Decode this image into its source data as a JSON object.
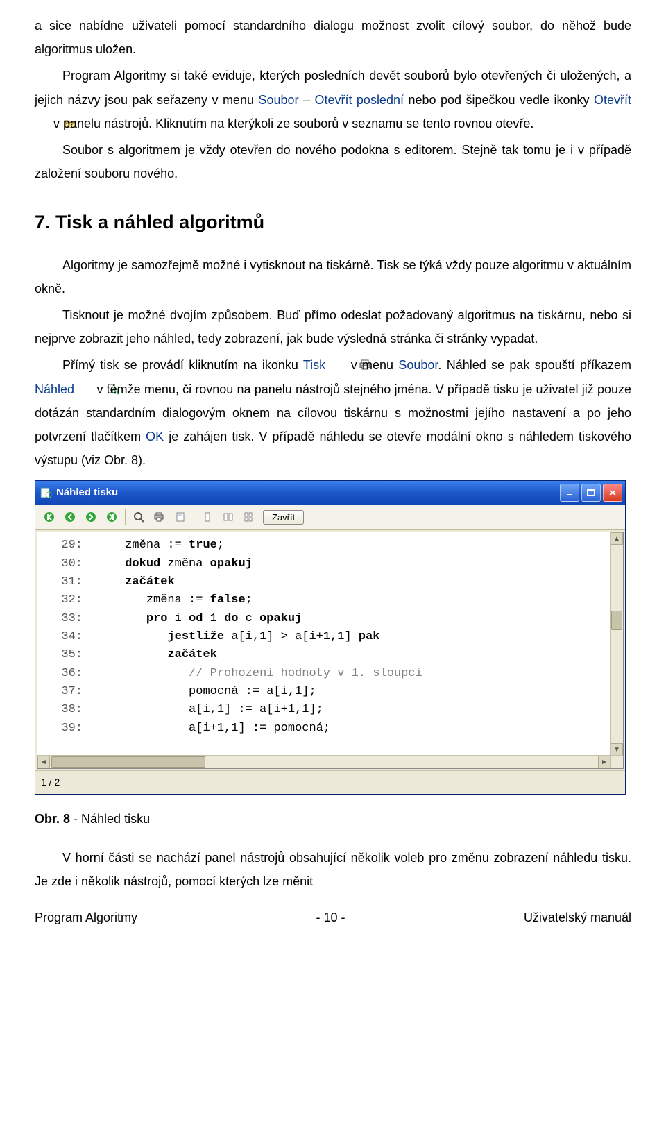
{
  "para1_a": "a sice nabídne uživateli pomocí standardního dialogu možnost zvolit cílový soubor, do něhož bude algoritmus uložen.",
  "para2_a": "Program Algoritmy si také eviduje, kterých posledních devět souborů bylo otevřených či uložených, a jejich názvy jsou pak seřazeny v menu ",
  "para2_menu1": "Soubor",
  "para2_dash": " – ",
  "para2_menu2": "Otevřít poslední",
  "para2_b": " nebo pod šipečkou vedle ikonky ",
  "para2_menu3": "Otevřít",
  "para2_c": " v panelu nástrojů. Kliknutím na kterýkoli ze souborů v seznamu se tento rovnou otevře.",
  "para3": "Soubor s algoritmem je vždy otevřen do nového podokna s editorem. Stejně tak tomu je i v případě založení souboru nového.",
  "section_title": "7. Tisk a náhled algoritmů",
  "para4": "Algoritmy je samozřejmě možné i vytisknout na tiskárně. Tisk se týká vždy pouze algoritmu v aktuálním okně.",
  "para5": "Tisknout je možné dvojím způsobem. Buď přímo odeslat požadovaný algoritmus na tiskárnu, nebo si nejprve zobrazit jeho náhled, tedy zobrazení, jak bude výsledná stránka či stránky vypadat.",
  "para6_a": "Přímý tisk se provádí kliknutím na ikonku ",
  "para6_menu1": "Tisk",
  "para6_b": " v menu ",
  "para6_menu2": "Soubor",
  "para6_c": ". Náhled se pak spouští příkazem ",
  "para6_menu3": "Náhled",
  "para6_d": " v témže menu, či rovnou na panelu nástrojů stejného jména. V případě tisku je uživatel již pouze dotázán standardním dialogovým oknem na cílovou tiskárnu s možnostmi jejího nastavení a po jeho potvrzení tlačítkem ",
  "para6_menu4": "OK",
  "para6_e": " je zahájen tisk. V případě náhledu se otevře modální okno s náhledem tiskového výstupu (viz Obr. 8).",
  "preview": {
    "window_title": "Náhled tisku",
    "close_label": "Zavřít",
    "code_lines": [
      {
        "n": "29:",
        "indent": 1,
        "plain": "změna := ",
        "kw": "true",
        "tail": ";"
      },
      {
        "n": "30:",
        "indent": 1,
        "plain": "",
        "kw": "dokud",
        "mid": " změna ",
        "kw2": "opakuj",
        "tail": ""
      },
      {
        "n": "31:",
        "indent": 1,
        "plain": "",
        "kw": "začátek",
        "tail": ""
      },
      {
        "n": "32:",
        "indent": 2,
        "plain": "změna := ",
        "kw": "false",
        "tail": ";"
      },
      {
        "n": "33:",
        "indent": 2,
        "plain": "",
        "kw": "pro",
        "mid": " i ",
        "kw2": "od",
        "mid2": " 1 ",
        "kw3": "do",
        "mid3": " c ",
        "kw4": "opakuj",
        "tail": ""
      },
      {
        "n": "34:",
        "indent": 3,
        "plain": "",
        "kw": "jestliže",
        "mid": " a[i,1] > a[i+1,1] ",
        "kw2": "pak",
        "tail": ""
      },
      {
        "n": "35:",
        "indent": 3,
        "plain": "",
        "kw": "začátek",
        "tail": ""
      },
      {
        "n": "36:",
        "indent": 4,
        "cmt": "// Prohození hodnoty v 1. sloupci"
      },
      {
        "n": "37:",
        "indent": 4,
        "plain": "pomocná := a[i,1];"
      },
      {
        "n": "38:",
        "indent": 4,
        "plain": "a[i,1] := a[i+1,1];"
      },
      {
        "n": "39:",
        "indent": 4,
        "plain": "a[i+1,1] := pomocná;"
      }
    ],
    "status": "1 / 2"
  },
  "figcaption_a": "Obr. 8",
  "figcaption_b": "   - Náhled tisku",
  "para7": "V horní části se nachází panel nástrojů obsahující několik voleb pro změnu zobrazení náhledu tisku. Je zde i několik nástrojů, pomocí kterých lze měnit",
  "footer_left": "Program Algoritmy",
  "footer_mid": "- 10 -",
  "footer_right": "Uživatelský manuál"
}
